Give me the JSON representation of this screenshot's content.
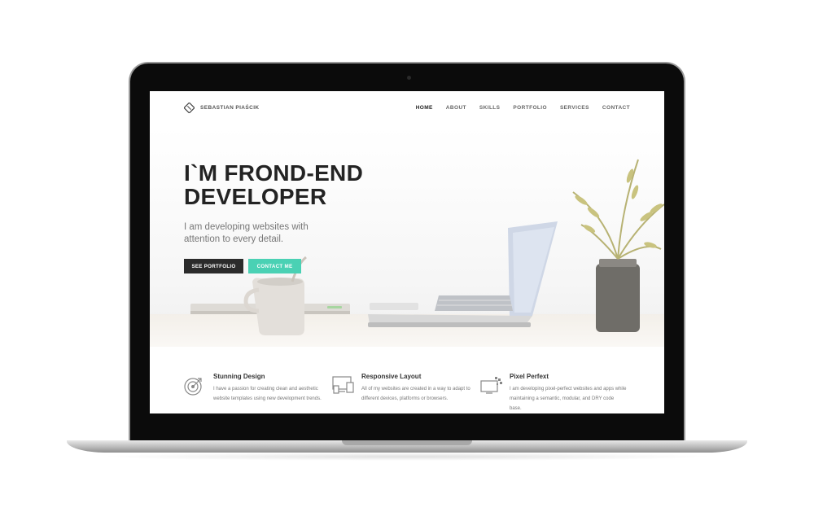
{
  "nav": {
    "brand": "SEBASTIAN PIAŚCIK",
    "items": [
      "HOME",
      "ABOUT",
      "SKILLS",
      "PORTFOLIO",
      "SERVICES",
      "CONTACT"
    ]
  },
  "hero": {
    "title_line1": "I`M FROND-END",
    "title_line2": "DEVELOPER",
    "subtitle": "I am developing websites with attention to every detail.",
    "btn_portfolio": "SEE PORTFOLIO",
    "btn_contact": "CONTACT ME"
  },
  "features": [
    {
      "title": "Stunning Design",
      "text": "I have a passion for creating clean and aesthetic website templates using new development trends.",
      "icon": "target-icon"
    },
    {
      "title": "Responsive Layout",
      "text": "All of my websites are created in a way to adapt to different devices, platforms or browsers.",
      "icon": "devices-icon"
    },
    {
      "title": "Pixel Perfext",
      "text": "I am developing pixel-perfect websites and apps while maintaining a semantic, modular, and DRY code base.",
      "icon": "pixel-monitor-icon"
    }
  ],
  "colors": {
    "accent": "#4ad1b4",
    "dark_button": "#2b2b2b",
    "heading": "#232323"
  }
}
